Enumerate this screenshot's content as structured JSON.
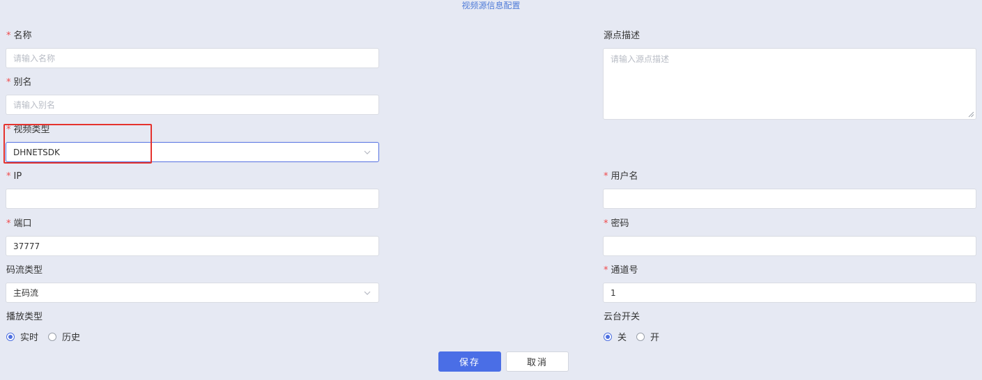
{
  "title": "视频源信息配置",
  "required_mark": "*",
  "colors": {
    "background": "#e6e9f3",
    "title": "#4f7bd8",
    "required": "#f0494a",
    "primary": "#4a6ee6",
    "highlight": "#e5322d"
  },
  "left": {
    "name": {
      "label": "名称",
      "required": true,
      "placeholder": "请输入名称",
      "value": ""
    },
    "alias": {
      "label": "别名",
      "required": true,
      "placeholder": "请输入别名",
      "value": ""
    },
    "video_type": {
      "label": "视频类型",
      "required": true,
      "value": "DHNETSDK",
      "icon": "chevron-down-icon"
    },
    "ip": {
      "label": "IP",
      "required": true,
      "value": ""
    },
    "port": {
      "label": "端口",
      "required": true,
      "value": "37777"
    },
    "stream_type": {
      "label": "码流类型",
      "required": false,
      "value": "主码流",
      "icon": "chevron-down-icon"
    },
    "play_type": {
      "label": "播放类型",
      "options": [
        {
          "label": "实时",
          "checked": true
        },
        {
          "label": "历史",
          "checked": false
        }
      ]
    }
  },
  "right": {
    "description": {
      "label": "源点描述",
      "required": false,
      "placeholder": "请输入源点描述",
      "value": ""
    },
    "username": {
      "label": "用户名",
      "required": true,
      "value": ""
    },
    "password": {
      "label": "密码",
      "required": true,
      "value": ""
    },
    "channel": {
      "label": "通道号",
      "required": true,
      "value": "1"
    },
    "ptz_switch": {
      "label": "云台开关",
      "options": [
        {
          "label": "关",
          "checked": true
        },
        {
          "label": "开",
          "checked": false
        }
      ]
    }
  },
  "buttons": {
    "save": "保存",
    "cancel": "取消"
  }
}
